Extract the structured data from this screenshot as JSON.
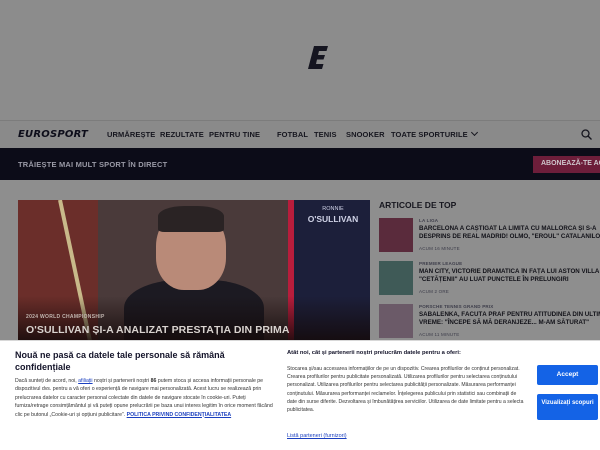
{
  "brand": {
    "name": "EUROSPORT",
    "logo_letter": "E"
  },
  "nav": {
    "items": [
      "URMĂREȘTE",
      "REZULTATE",
      "PENTRU TINE",
      "FOTBAL",
      "TENIS",
      "SNOOKER",
      "TOATE SPORTURILE"
    ]
  },
  "promo": {
    "text": "TRĂIEȘTE MAI MULT SPORT ÎN DIRECT",
    "button": "ABONEAZĂ-TE ACUM"
  },
  "hero": {
    "board_first": "RONNIE",
    "board_last": "O'SULLIVAN",
    "label": "2024 WORLD CHAMPIONSHIP",
    "title": "O'SULLIVAN ȘI-A ANALIZAT PRESTAȚIA DIN PRIMA"
  },
  "top": {
    "heading": "ARTICOLE DE TOP",
    "articles": [
      {
        "category": "LA LIGA",
        "title": "BARCELONA A CÂȘTIGAT LA LIMITĂ CU MALLORCA ȘI S-A\nDESPRINS DE REAL MADRID! OLMO, \"EROUL\" CATALANILOR",
        "time": "ACUM 16 MINUTE",
        "color": "#5a2b3c"
      },
      {
        "category": "PREMIER LEAGUE",
        "title": "MAN CITY, VICTORIE DRAMATICĂ ÎN FAȚA LUI ASTON VILLA\n\"CETĂȚENII\" AU LUAT PUNCTELE ÎN PRELUNGIRI",
        "time": "ACUM 2 ORE",
        "color": "#3f5a57"
      },
      {
        "category": "PORSCHE TENNIS GRAND PRIX",
        "title": "SABALENKA, FĂCUTĂ PRAF PENTRU ATITUDINEA DIN ULTIMA\nVREME: \"ÎNCEPE SĂ MĂ DERANJEZE... M-AM SĂTURAT\"",
        "time": "ACUM 11 MINUTE",
        "color": "#6b5a68"
      }
    ]
  },
  "consent": {
    "title": "Nouă ne pasă ca datele tale personale să rămână confidențiale",
    "body_1": "Dacă sunteți de acord, noi,",
    "link_1": "afiliații",
    "body_2": "noștri și partenerii noștri",
    "count": "86",
    "body_3": "putem stoca și accesa informații personale pe dispozitivul dvs. pentru a vă oferi o experiență de navigare mai personalizată. Acest lucru se realizează prin prelucrarea datelor cu caracter personal colectate din datele de navigare stocate în cookie-uri. Puteți furniza/retrage consimțământul și vă puteți opune prelucrării pe baza unui interes legitim în orice moment făcând clic pe butonul „Cookie-uri și opțiuni publicitare”.",
    "policy_link": "POLITICA PRIVIND CONFIDENȚIALITATEA",
    "right_title": "Atât noi, cât și partenerii noștri prelucrăm datele pentru a oferi:",
    "right_body": "Stocarea și/sau accesarea informațiilor de pe un dispozitiv. Crearea profilurilor de conținut personalizat. Crearea profilurilor pentru publicitate personalizată. Utilizarea profilurilor pentru selectarea conținutului personalizat. Utilizarea profilurilor pentru selectarea publicității personalizate. Măsurarea performanței conținutului. Măsurarea performanței reclamelor. Înțelegerea publicului prin statistici sau combinații de date din surse diferite. Dezvoltarea și îmbunătățirea serviciilor. Utilizarea de date limitate pentru a selecta publicitatea.",
    "partners_link": "Listă parteneri (furnizori)",
    "accept": "Accept",
    "purposes": "Vizualizați scopuri"
  }
}
